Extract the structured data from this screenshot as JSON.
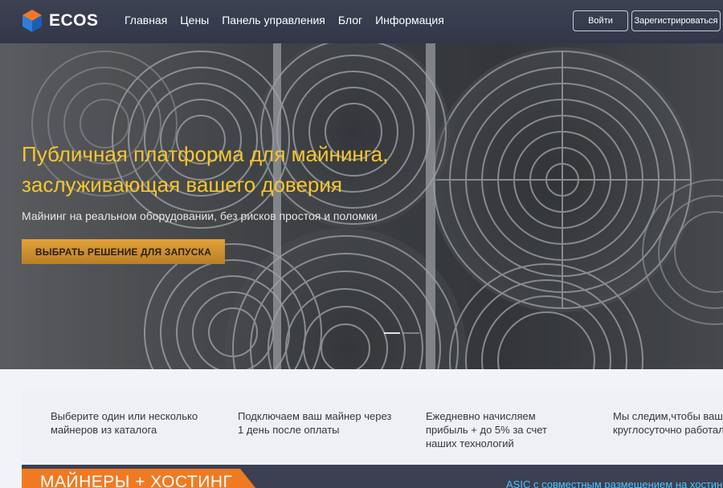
{
  "header": {
    "logo_text": "ECOS",
    "nav": [
      "Главная",
      "Цены",
      "Панель управления",
      "Блог",
      "Информация"
    ],
    "login_label": "Войти",
    "register_label": "Зарегистрироваться"
  },
  "hero": {
    "title": "Публичная платформа для майнинга, заслуживающая вашего доверия",
    "subtitle": "Майнинг на реальном оборудовании, без рисков простоя и поломки",
    "cta_label": "ВЫБРАТЬ РЕШЕНИЕ ДЛЯ ЗАПУСКА",
    "slides_total": 2,
    "slide_active": 1
  },
  "features": [
    "Выберите один или несколько майнеров из каталога",
    "Подключаем ваш майнер через 1 день после оплаты",
    "Ежедневно начисляем прибыль + до 5% за счет наших технологий",
    "Мы следим,чтобы ваш круглосуточно работал"
  ],
  "bottom": {
    "tab_label": "МАЙНЕРЫ + ХОСТИНГ",
    "asic_link": "ASIC с совместным размещением на хостинге"
  },
  "colors": {
    "header_bg": "#373b4e",
    "hero_title": "#f7c72d",
    "cta_bg": "#d49632",
    "orange_tab": "#f07a22",
    "link": "#4fc3f7"
  }
}
